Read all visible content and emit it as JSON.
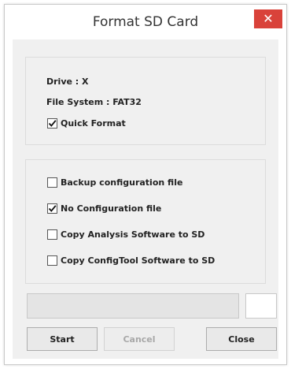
{
  "window": {
    "title": "Format SD Card",
    "close_glyph": "✕"
  },
  "drive_group": {
    "drive": "Drive : X",
    "file_system": "File System : FAT32",
    "quick_format": {
      "label": "Quick Format",
      "checked": true
    }
  },
  "options_group": {
    "items": [
      {
        "label": "Backup configuration file",
        "checked": false
      },
      {
        "label": "No Configuration file",
        "checked": true
      },
      {
        "label": "Copy Analysis Software to SD",
        "checked": false
      },
      {
        "label": "Copy ConfigTool Software to SD",
        "checked": false
      }
    ]
  },
  "progress": {
    "value_percent": 0
  },
  "buttons": {
    "start": "Start",
    "cancel": "Cancel",
    "close": "Close",
    "cancel_enabled": false
  },
  "colors": {
    "close_button": "#d9423a",
    "dialog_bg": "#f0f0f0"
  }
}
